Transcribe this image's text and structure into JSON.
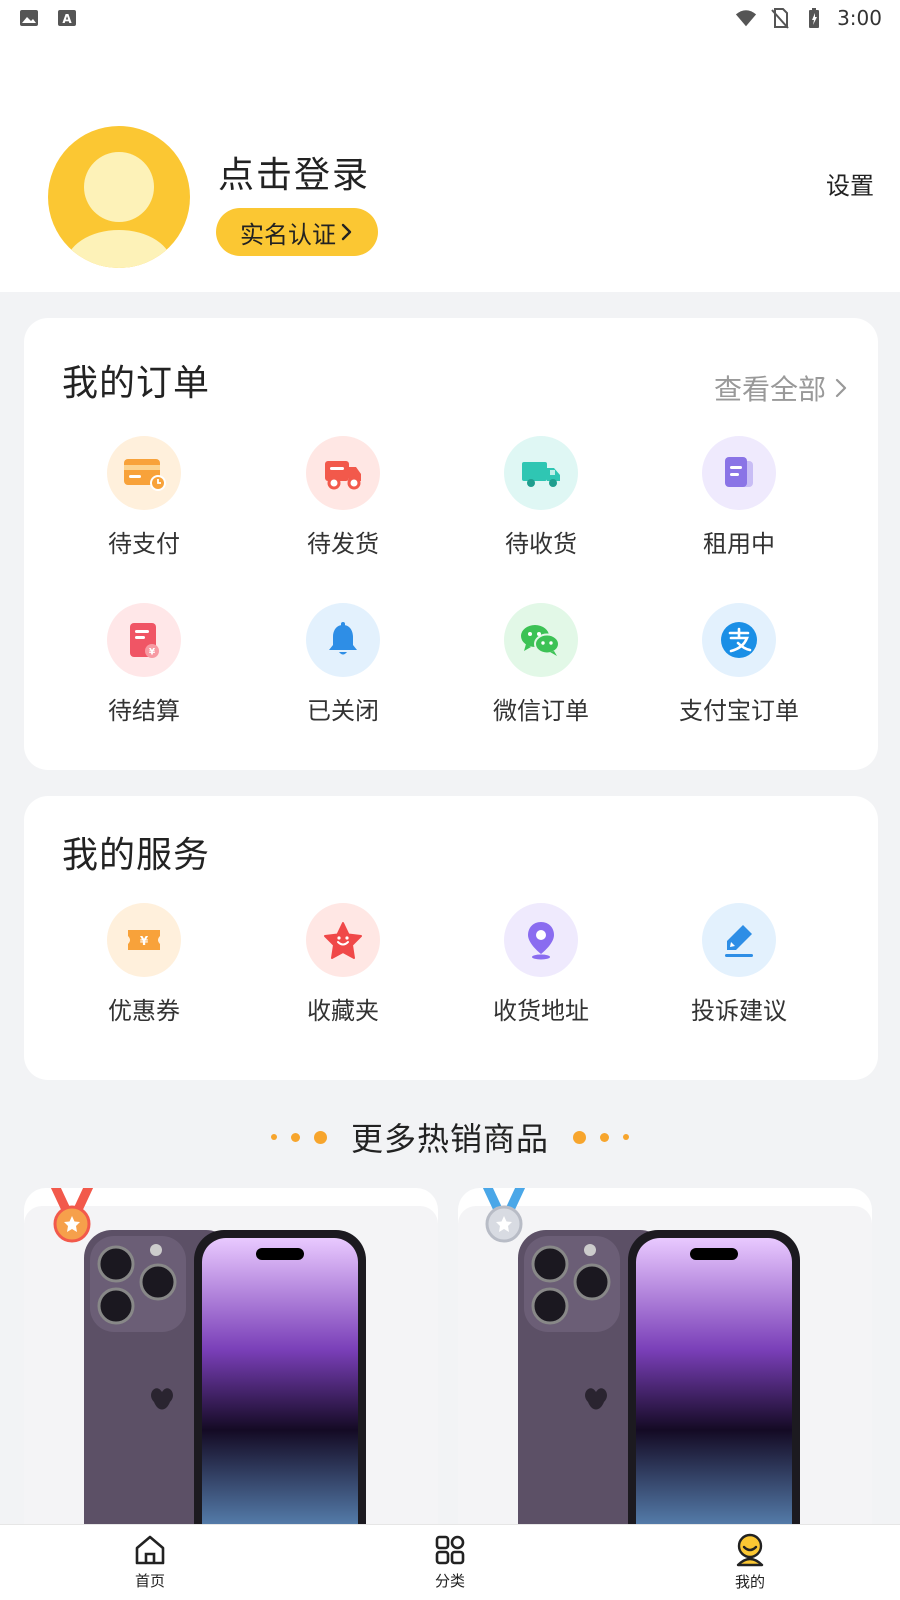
{
  "status_bar": {
    "time": "3:00"
  },
  "profile": {
    "login_prompt": "点击登录",
    "verify_label": "实名认证",
    "settings_label": "设置"
  },
  "orders": {
    "title": "我的订单",
    "view_all": "查看全部",
    "items": [
      {
        "label": "待支付",
        "icon": "card-icon",
        "bg": "#fff0dc",
        "fg": "#f8a23a"
      },
      {
        "label": "待发货",
        "icon": "truck-icon",
        "bg": "#ffe7e4",
        "fg": "#f2594b"
      },
      {
        "label": "待收货",
        "icon": "delivery-truck-icon",
        "bg": "#dff7f4",
        "fg": "#2fc6b3"
      },
      {
        "label": "租用中",
        "icon": "document-icon",
        "bg": "#efeafd",
        "fg": "#8a74e6"
      },
      {
        "label": "待结算",
        "icon": "bill-icon",
        "bg": "#ffe7e8",
        "fg": "#f05565"
      },
      {
        "label": "已关闭",
        "icon": "bell-icon",
        "bg": "#e3f1fd",
        "fg": "#2e8ee6"
      },
      {
        "label": "微信订单",
        "icon": "wechat-icon",
        "bg": "#e2f8e7",
        "fg": "#3cc255"
      },
      {
        "label": "支付宝订单",
        "icon": "alipay-icon",
        "bg": "#e3f1fd",
        "fg": "#1a8fe6"
      }
    ]
  },
  "services": {
    "title": "我的服务",
    "items": [
      {
        "label": "优惠券",
        "icon": "coupon-icon",
        "bg": "#fff0dc",
        "fg": "#f8a23a"
      },
      {
        "label": "收藏夹",
        "icon": "star-icon",
        "bg": "#ffe7e4",
        "fg": "#f04848"
      },
      {
        "label": "收货地址",
        "icon": "location-pin-icon",
        "bg": "#efeafd",
        "fg": "#8a6cf0"
      },
      {
        "label": "投诉建议",
        "icon": "edit-pen-icon",
        "bg": "#e3f1fd",
        "fg": "#2e8ee6"
      }
    ]
  },
  "hot": {
    "title": "更多热销商品",
    "products": [
      {
        "medal": "gold-medal-icon"
      },
      {
        "medal": "silver-medal-icon"
      }
    ]
  },
  "tab_bar": {
    "tabs": [
      {
        "label": "首页",
        "icon": "home-icon"
      },
      {
        "label": "分类",
        "icon": "grid-icon"
      },
      {
        "label": "我的",
        "icon": "profile-icon"
      }
    ]
  },
  "colors": {
    "accent": "#fbc733",
    "dot": "#f7a52d"
  }
}
